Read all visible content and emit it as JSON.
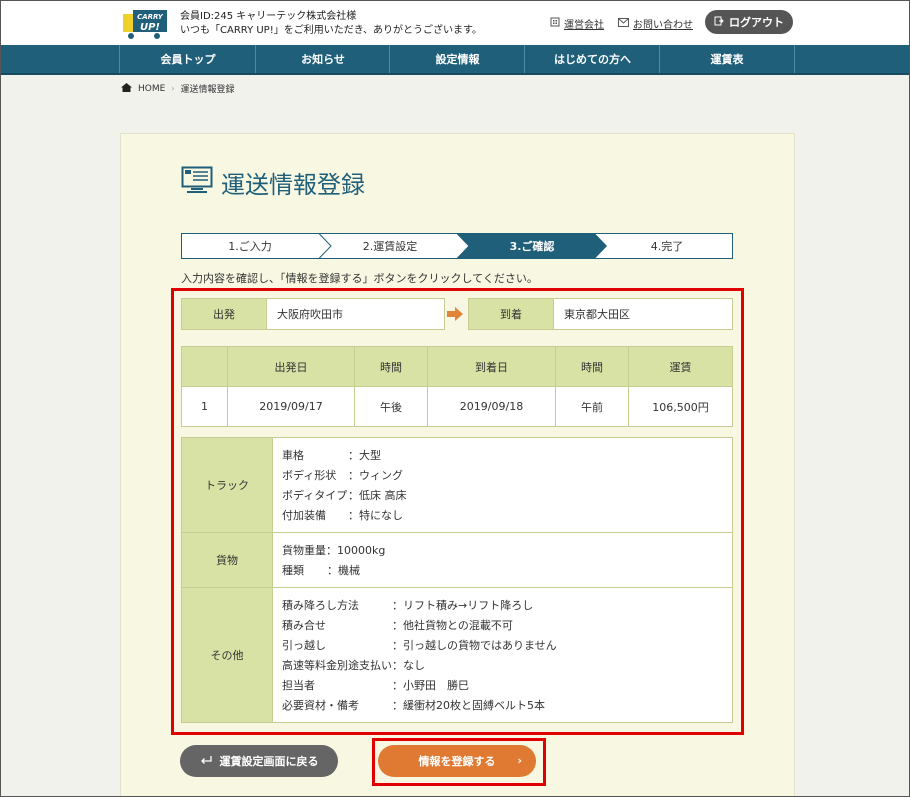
{
  "header": {
    "member_line1": "会員ID:245 キャリーテック株式会社様",
    "member_line2": "いつも「CARRY UP!」をご利用いただき、ありがとうございます。",
    "logo_text_top": "CARRY",
    "logo_text_bottom": "UP!",
    "link_company": "運営会社",
    "link_contact": "お問い合わせ",
    "logout": "ログアウト",
    "colors": {
      "nav": "#1f5f7a",
      "accent": "#e07a33",
      "label_bg": "#d9e2a5"
    }
  },
  "nav": [
    "会員トップ",
    "お知らせ",
    "設定情報",
    "はじめての方へ",
    "運賃表"
  ],
  "breadcrumb": {
    "home": "HOME",
    "current": "運送情報登録"
  },
  "page_title": "運送情報登録",
  "steps": [
    "1.ご入力",
    "2.運賃設定",
    "3.ご確認",
    "4.完了"
  ],
  "note": "入力内容を確認し、「情報を登録する」ボタンをクリックしてください。",
  "route": {
    "departure_label": "出発",
    "departure_value": "大阪府吹田市",
    "arrival_label": "到着",
    "arrival_value": "東京都大田区"
  },
  "schedule": {
    "headers": [
      "",
      "出発日",
      "時間",
      "到着日",
      "時間",
      "運賃"
    ],
    "rows": [
      [
        "1",
        "2019/09/17",
        "午後",
        "2019/09/18",
        "午前",
        "106,500円"
      ]
    ]
  },
  "truck": {
    "label": "トラック",
    "lines": [
      {
        "k": "車格",
        "v": "：大型"
      },
      {
        "k": "ボディ形状",
        "v": "：ウィング"
      },
      {
        "k": "ボディタイプ",
        "v": "：低床 高床"
      },
      {
        "k": "付加装備",
        "v": "：特になし"
      }
    ]
  },
  "cargo": {
    "label": "貨物",
    "lines": [
      {
        "k": "貨物重量",
        "v": "：10000kg"
      },
      {
        "k": "種類",
        "v": "：機械"
      }
    ]
  },
  "other": {
    "label": "その他",
    "lines": [
      {
        "k": "積み降ろし方法",
        "v": "：リフト積み→リフト降ろし"
      },
      {
        "k": "積み合せ",
        "v": "：他社貨物との混載不可"
      },
      {
        "k": "引っ越し",
        "v": "：引っ越しの貨物ではありません"
      },
      {
        "k": "高速等料金別途支払い",
        "v": "：なし"
      },
      {
        "k": "担当者",
        "v": "：小野田　勝巳"
      },
      {
        "k": "必要資材・備考",
        "v": "：緩衝材20枚と固縛ベルト5本"
      }
    ]
  },
  "buttons": {
    "back": "運賃設定画面に戻る",
    "submit": "情報を登録する"
  }
}
